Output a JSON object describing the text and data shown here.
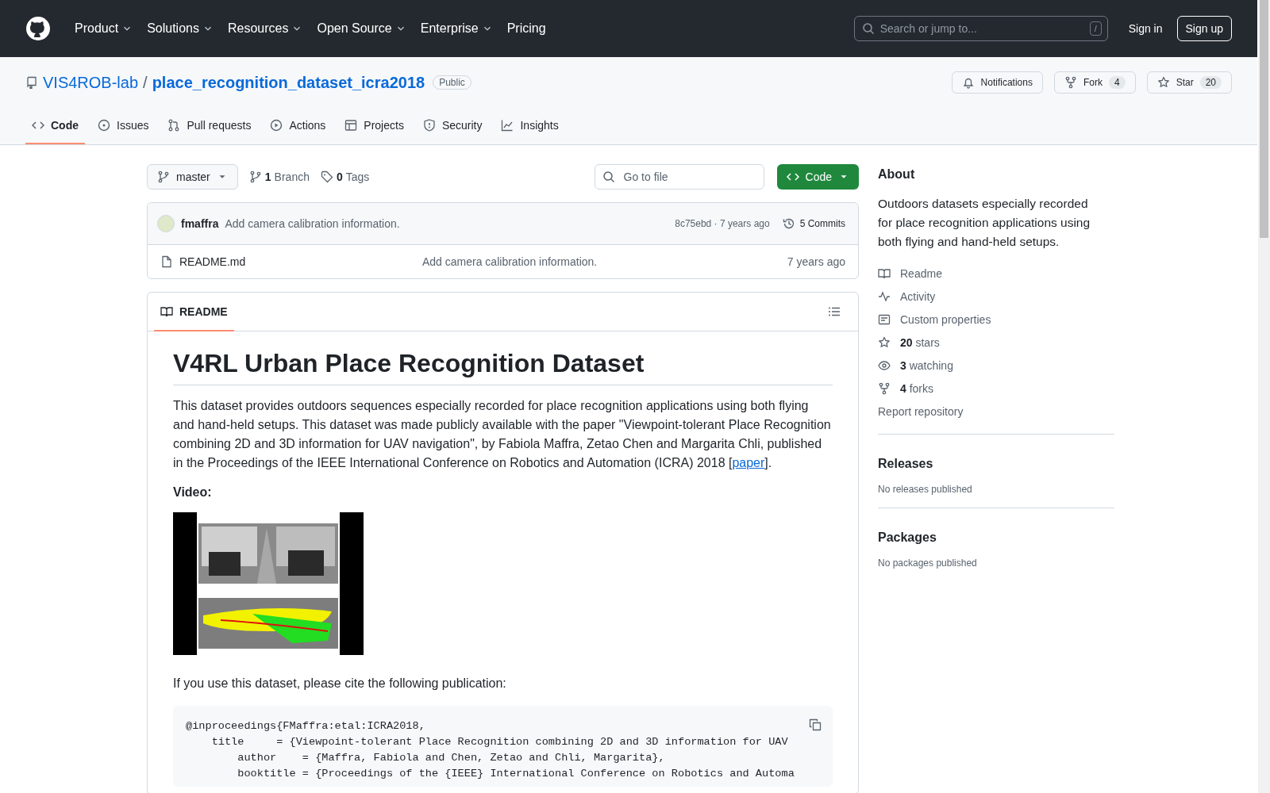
{
  "header": {
    "nav": [
      {
        "label": "Product",
        "dropdown": true
      },
      {
        "label": "Solutions",
        "dropdown": true
      },
      {
        "label": "Resources",
        "dropdown": true
      },
      {
        "label": "Open Source",
        "dropdown": true
      },
      {
        "label": "Enterprise",
        "dropdown": true
      },
      {
        "label": "Pricing",
        "dropdown": false
      }
    ],
    "search": {
      "placeholder": "Search or jump to...",
      "shortcut": "/"
    },
    "sign_in": "Sign in",
    "sign_up": "Sign up"
  },
  "repo": {
    "owner": "VIS4ROB-lab",
    "separator": "/",
    "name": "place_recognition_dataset_icra2018",
    "visibility": "Public",
    "actions": [
      {
        "kind": "notifications",
        "label": "Notifications"
      },
      {
        "kind": "fork",
        "label": "Fork",
        "count": "4"
      },
      {
        "kind": "star",
        "label": "Star",
        "count": "20"
      }
    ]
  },
  "tabs": [
    {
      "label": "Code",
      "selected": true
    },
    {
      "label": "Issues",
      "selected": false
    },
    {
      "label": "Pull requests",
      "selected": false
    },
    {
      "label": "Actions",
      "selected": false
    },
    {
      "label": "Projects",
      "selected": false
    },
    {
      "label": "Security",
      "selected": false
    },
    {
      "label": "Insights",
      "selected": false
    }
  ],
  "toolbar": {
    "branch": "master",
    "branch_count": "1",
    "branch_label": "Branch",
    "tag_count": "0",
    "tag_label": "Tags",
    "go_to_file": {
      "placeholder": "Go to file"
    },
    "code_button": "Code"
  },
  "commit": {
    "author": "fmaffra",
    "message": "Add camera calibration information.",
    "hash_time": "8c75ebd · 7 years ago",
    "commits": "5 Commits"
  },
  "files": [
    {
      "name": "README.md",
      "message": "Add camera calibration information.",
      "time": "7 years ago"
    }
  ],
  "readme": {
    "tab": "README",
    "title": "V4RL Urban Place Recognition Dataset",
    "intro": "This dataset provides outdoors sequences especially recorded for place recognition applications using both flying and hand-held setups. This dataset was made publicly available with the paper \"Viewpoint-tolerant Place Recognition combining 2D and 3D information for UAV navigation\", by Fabiola Maffra, Zetao Chen and Margarita Chli, published in the Proceedings of the IEEE International Conference on Robotics and Automation (ICRA) 2018 [",
    "intro_link": "paper",
    "intro_end": "].",
    "video_heading": "Video:",
    "cite": "If you use this dataset, please cite the following publication:",
    "code": [
      "@inproceedings{FMaffra:etal:ICRA2018,",
      "    title     = {Viewpoint-tolerant Place Recognition combining 2D and 3D information for UAV",
      "        author    = {Maffra, Fabiola and Chen, Zetao and Chli, Margarita},",
      "        booktitle = {Proceedings of the {IEEE} International Conference on Robotics and Automa"
    ]
  },
  "about": {
    "heading": "About",
    "description": "Outdoors datasets especially recorded for place recognition applications using both flying and hand-held setups.",
    "links": [
      {
        "text": "Readme"
      },
      {
        "text": "Activity"
      },
      {
        "text": "Custom properties"
      },
      {
        "text": "**20** stars"
      },
      {
        "text": "**3** watching"
      },
      {
        "text": "**4** forks"
      },
      {
        "text": "Report repository"
      }
    ]
  },
  "releases": {
    "heading": "Releases",
    "note": "No releases published"
  },
  "packages": {
    "heading": "Packages",
    "note": "No packages published"
  }
}
